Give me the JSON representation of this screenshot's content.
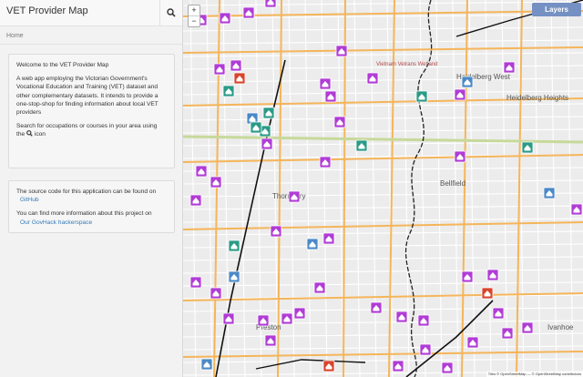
{
  "app": {
    "title": "VET Provider Map"
  },
  "breadcrumb": {
    "home": "Home"
  },
  "welcome": {
    "heading": "Welcome to the VET Provider Map",
    "body": "A web app employing the Victorian Government's Vocational Education and Training (VET) dataset and other complementary datasets. It intends to provide a one-stop-shop for finding information about local VET providers",
    "search_hint_prefix": "Search for occupations or courses in your area using the",
    "search_hint_suffix": "icon"
  },
  "source": {
    "code_text": "The source code for this application can be found on",
    "code_link": "GitHub",
    "more_text": "You can find more information about this project on",
    "more_link": "Our GovHack hackerspace"
  },
  "map": {
    "zoom_in": "+",
    "zoom_out": "−",
    "layers_label": "Layers",
    "attribution": "Tiles © OpenStreetMap — © OpenStreetMap contributors",
    "labels": [
      "Heidelberg West",
      "Heidelberg Heights",
      "Bellfield",
      "Thornbury",
      "Ivanhoe",
      "Preston",
      "Vietnam Vetrans Wetland"
    ],
    "colors": {
      "provider_purple": "#b13cd6",
      "provider_teal": "#2a9b86",
      "provider_blue": "#4a89c8",
      "provider_red": "#d9442c",
      "river": "#222222",
      "railway": "#111111",
      "major_road": "#f5b55a"
    }
  }
}
